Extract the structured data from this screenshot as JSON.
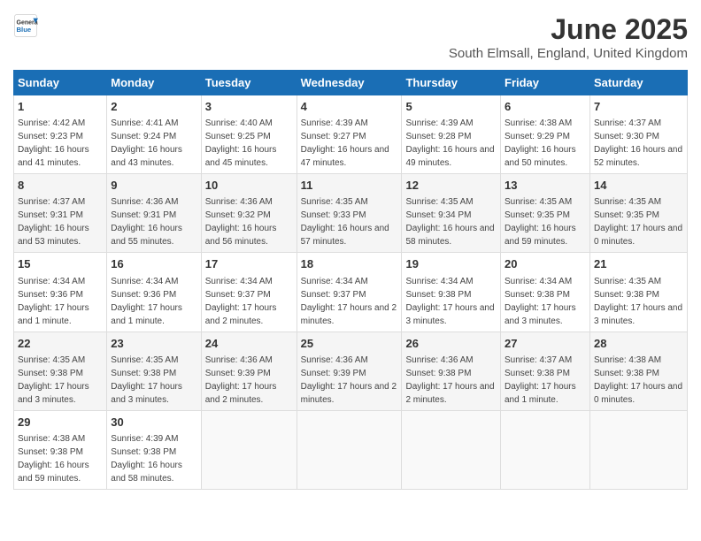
{
  "header": {
    "logo_general": "General",
    "logo_blue": "Blue",
    "title": "June 2025",
    "subtitle": "South Elmsall, England, United Kingdom"
  },
  "weekdays": [
    "Sunday",
    "Monday",
    "Tuesday",
    "Wednesday",
    "Thursday",
    "Friday",
    "Saturday"
  ],
  "weeks": [
    [
      {
        "day": "1",
        "sunrise": "Sunrise: 4:42 AM",
        "sunset": "Sunset: 9:23 PM",
        "daylight": "Daylight: 16 hours and 41 minutes."
      },
      {
        "day": "2",
        "sunrise": "Sunrise: 4:41 AM",
        "sunset": "Sunset: 9:24 PM",
        "daylight": "Daylight: 16 hours and 43 minutes."
      },
      {
        "day": "3",
        "sunrise": "Sunrise: 4:40 AM",
        "sunset": "Sunset: 9:25 PM",
        "daylight": "Daylight: 16 hours and 45 minutes."
      },
      {
        "day": "4",
        "sunrise": "Sunrise: 4:39 AM",
        "sunset": "Sunset: 9:27 PM",
        "daylight": "Daylight: 16 hours and 47 minutes."
      },
      {
        "day": "5",
        "sunrise": "Sunrise: 4:39 AM",
        "sunset": "Sunset: 9:28 PM",
        "daylight": "Daylight: 16 hours and 49 minutes."
      },
      {
        "day": "6",
        "sunrise": "Sunrise: 4:38 AM",
        "sunset": "Sunset: 9:29 PM",
        "daylight": "Daylight: 16 hours and 50 minutes."
      },
      {
        "day": "7",
        "sunrise": "Sunrise: 4:37 AM",
        "sunset": "Sunset: 9:30 PM",
        "daylight": "Daylight: 16 hours and 52 minutes."
      }
    ],
    [
      {
        "day": "8",
        "sunrise": "Sunrise: 4:37 AM",
        "sunset": "Sunset: 9:31 PM",
        "daylight": "Daylight: 16 hours and 53 minutes."
      },
      {
        "day": "9",
        "sunrise": "Sunrise: 4:36 AM",
        "sunset": "Sunset: 9:31 PM",
        "daylight": "Daylight: 16 hours and 55 minutes."
      },
      {
        "day": "10",
        "sunrise": "Sunrise: 4:36 AM",
        "sunset": "Sunset: 9:32 PM",
        "daylight": "Daylight: 16 hours and 56 minutes."
      },
      {
        "day": "11",
        "sunrise": "Sunrise: 4:35 AM",
        "sunset": "Sunset: 9:33 PM",
        "daylight": "Daylight: 16 hours and 57 minutes."
      },
      {
        "day": "12",
        "sunrise": "Sunrise: 4:35 AM",
        "sunset": "Sunset: 9:34 PM",
        "daylight": "Daylight: 16 hours and 58 minutes."
      },
      {
        "day": "13",
        "sunrise": "Sunrise: 4:35 AM",
        "sunset": "Sunset: 9:35 PM",
        "daylight": "Daylight: 16 hours and 59 minutes."
      },
      {
        "day": "14",
        "sunrise": "Sunrise: 4:35 AM",
        "sunset": "Sunset: 9:35 PM",
        "daylight": "Daylight: 17 hours and 0 minutes."
      }
    ],
    [
      {
        "day": "15",
        "sunrise": "Sunrise: 4:34 AM",
        "sunset": "Sunset: 9:36 PM",
        "daylight": "Daylight: 17 hours and 1 minute."
      },
      {
        "day": "16",
        "sunrise": "Sunrise: 4:34 AM",
        "sunset": "Sunset: 9:36 PM",
        "daylight": "Daylight: 17 hours and 1 minute."
      },
      {
        "day": "17",
        "sunrise": "Sunrise: 4:34 AM",
        "sunset": "Sunset: 9:37 PM",
        "daylight": "Daylight: 17 hours and 2 minutes."
      },
      {
        "day": "18",
        "sunrise": "Sunrise: 4:34 AM",
        "sunset": "Sunset: 9:37 PM",
        "daylight": "Daylight: 17 hours and 2 minutes."
      },
      {
        "day": "19",
        "sunrise": "Sunrise: 4:34 AM",
        "sunset": "Sunset: 9:38 PM",
        "daylight": "Daylight: 17 hours and 3 minutes."
      },
      {
        "day": "20",
        "sunrise": "Sunrise: 4:34 AM",
        "sunset": "Sunset: 9:38 PM",
        "daylight": "Daylight: 17 hours and 3 minutes."
      },
      {
        "day": "21",
        "sunrise": "Sunrise: 4:35 AM",
        "sunset": "Sunset: 9:38 PM",
        "daylight": "Daylight: 17 hours and 3 minutes."
      }
    ],
    [
      {
        "day": "22",
        "sunrise": "Sunrise: 4:35 AM",
        "sunset": "Sunset: 9:38 PM",
        "daylight": "Daylight: 17 hours and 3 minutes."
      },
      {
        "day": "23",
        "sunrise": "Sunrise: 4:35 AM",
        "sunset": "Sunset: 9:38 PM",
        "daylight": "Daylight: 17 hours and 3 minutes."
      },
      {
        "day": "24",
        "sunrise": "Sunrise: 4:36 AM",
        "sunset": "Sunset: 9:39 PM",
        "daylight": "Daylight: 17 hours and 2 minutes."
      },
      {
        "day": "25",
        "sunrise": "Sunrise: 4:36 AM",
        "sunset": "Sunset: 9:39 PM",
        "daylight": "Daylight: 17 hours and 2 minutes."
      },
      {
        "day": "26",
        "sunrise": "Sunrise: 4:36 AM",
        "sunset": "Sunset: 9:38 PM",
        "daylight": "Daylight: 17 hours and 2 minutes."
      },
      {
        "day": "27",
        "sunrise": "Sunrise: 4:37 AM",
        "sunset": "Sunset: 9:38 PM",
        "daylight": "Daylight: 17 hours and 1 minute."
      },
      {
        "day": "28",
        "sunrise": "Sunrise: 4:38 AM",
        "sunset": "Sunset: 9:38 PM",
        "daylight": "Daylight: 17 hours and 0 minutes."
      }
    ],
    [
      {
        "day": "29",
        "sunrise": "Sunrise: 4:38 AM",
        "sunset": "Sunset: 9:38 PM",
        "daylight": "Daylight: 16 hours and 59 minutes."
      },
      {
        "day": "30",
        "sunrise": "Sunrise: 4:39 AM",
        "sunset": "Sunset: 9:38 PM",
        "daylight": "Daylight: 16 hours and 58 minutes."
      },
      null,
      null,
      null,
      null,
      null
    ]
  ]
}
